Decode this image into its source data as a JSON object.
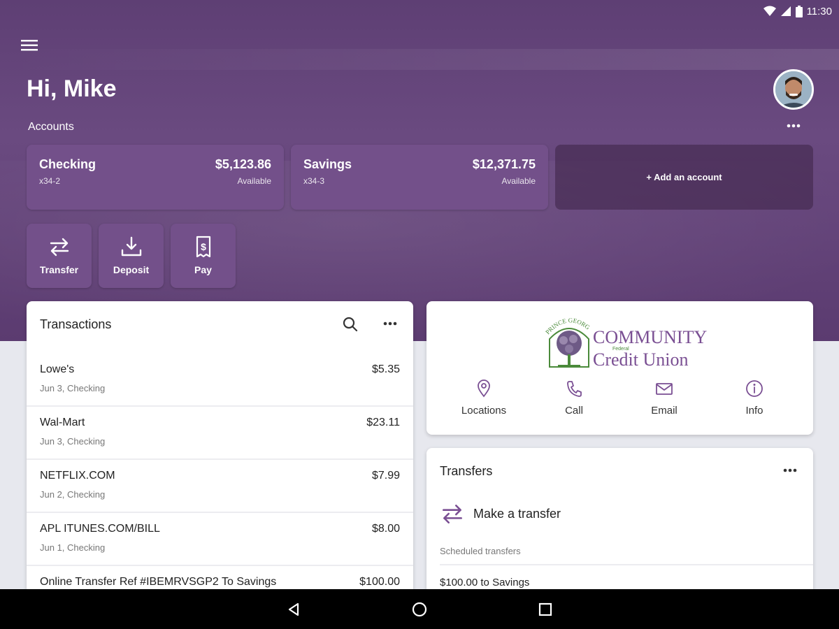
{
  "status": {
    "time": "11:30"
  },
  "header": {
    "greeting": "Hi, Mike",
    "accounts_label": "Accounts"
  },
  "accounts": [
    {
      "name": "Checking",
      "number": "x34-2",
      "balance": "$5,123.86",
      "balance_label": "Available"
    },
    {
      "name": "Savings",
      "number": "x34-3",
      "balance": "$12,371.75",
      "balance_label": "Available"
    }
  ],
  "add_account_label": "+ Add an account",
  "quick_actions": [
    {
      "label": "Transfer",
      "icon": "transfer-icon"
    },
    {
      "label": "Deposit",
      "icon": "deposit-icon"
    },
    {
      "label": "Pay",
      "icon": "pay-icon"
    }
  ],
  "transactions": {
    "title": "Transactions",
    "items": [
      {
        "description": "Lowe's",
        "meta": "Jun 3, Checking",
        "amount": "$5.35"
      },
      {
        "description": "Wal-Mart",
        "meta": "Jun 3, Checking",
        "amount": "$23.11"
      },
      {
        "description": "NETFLIX.COM",
        "meta": "Jun 2, Checking",
        "amount": "$7.99"
      },
      {
        "description": "APL ITUNES.COM/BILL",
        "meta": "Jun 1, Checking",
        "amount": "$8.00"
      },
      {
        "description": "Online Transfer Ref #IBEMRVSGP2 To Savings",
        "meta": "",
        "amount": "$100.00"
      }
    ]
  },
  "credit_union": {
    "logo_arc": "PRINCE GEORGE'S",
    "logo_main": "COMMUNITY",
    "logo_small": "Federal",
    "logo_sub": "Credit Union",
    "actions": [
      {
        "label": "Locations",
        "icon": "location-pin-icon"
      },
      {
        "label": "Call",
        "icon": "phone-icon"
      },
      {
        "label": "Email",
        "icon": "email-icon"
      },
      {
        "label": "Info",
        "icon": "info-icon"
      }
    ]
  },
  "transfers": {
    "title": "Transfers",
    "make_label": "Make a transfer",
    "scheduled_label": "Scheduled transfers",
    "scheduled": [
      {
        "text": "$100.00 to Savings"
      }
    ]
  },
  "colors": {
    "brand_purple": "#73508a",
    "hero_purple": "#5e3f74",
    "logo_green": "#4a8a3a",
    "logo_purple": "#7a4f93"
  }
}
